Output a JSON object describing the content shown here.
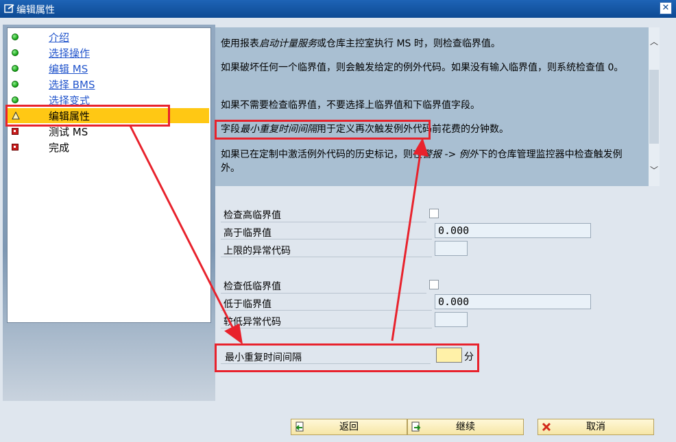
{
  "window": {
    "title": "编辑属性",
    "close_icon": "close-icon"
  },
  "steps": [
    {
      "label": "介绍",
      "status": "done",
      "link": true
    },
    {
      "label": "选择操作",
      "status": "done",
      "link": true
    },
    {
      "label": "编辑 MS",
      "status": "done",
      "link": true
    },
    {
      "label": "选择 BMS",
      "status": "done",
      "link": true
    },
    {
      "label": "选择变式",
      "status": "done",
      "link": true
    },
    {
      "label": "编辑属性",
      "status": "current",
      "link": false
    },
    {
      "label": "测试 MS",
      "status": "pending",
      "link": false
    },
    {
      "label": "完成",
      "status": "pending",
      "link": false
    }
  ],
  "help": {
    "p1_a": "使用报表",
    "p1_b": "启动计量服务",
    "p1_c": "或仓库主控室执行 MS 时，则检查临界值。",
    "p2": "如果破坏任何一个临界值，则会触发给定的例外代码。如果没有输入临界值，则系统检查值 0。",
    "p3": "如果不需要检查临界值，不要选择上临界值和下临界值字段。",
    "p4_a": "字段",
    "p4_b": "最小重复时间间隔",
    "p4_c": "用于定义再次触发例外代码前花费的分钟数。",
    "p5_a": "如果已在定制中激活例外代码的历史标记，则在",
    "p5_b": "警报 -> 例外",
    "p5_c": "下的仓库管理监控器中检查触发例外。"
  },
  "form": {
    "check_high_label": "检查高临界值",
    "check_high": false,
    "above_label": "高于临界值",
    "above_value": "0.000",
    "upper_code_label": "上限的异常代码",
    "upper_code_value": "",
    "check_low_label": "检查低临界值",
    "check_low": false,
    "below_label": "低于临界值",
    "below_value": "0.000",
    "lower_code_label": "较低异常代码",
    "lower_code_value": "",
    "min_interval_label": "最小重复时间间隔",
    "min_interval_value": "",
    "min_interval_unit": "分"
  },
  "buttons": {
    "back": "返回",
    "continue": "继续",
    "cancel": "取消"
  },
  "colors": {
    "annotation": "#e8222c",
    "current_step": "#ffc814",
    "title_bar": "#1e64b6"
  }
}
